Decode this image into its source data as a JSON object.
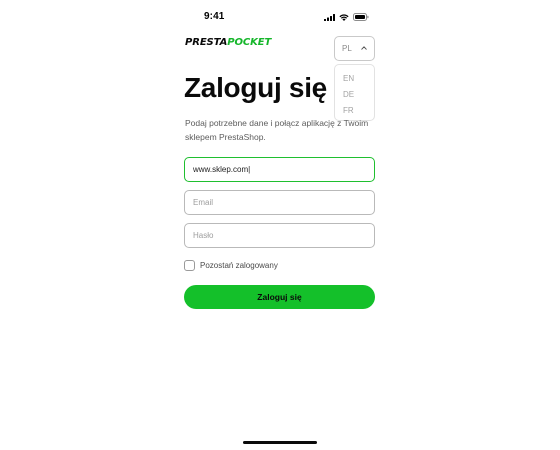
{
  "status_bar": {
    "time": "9:41",
    "icons": [
      "cellular-signal-icon",
      "wifi-icon",
      "battery-icon"
    ]
  },
  "header": {
    "logo_part1": "PRESTA",
    "logo_part2": "POCKET",
    "language": {
      "selected": "PL",
      "options": [
        "EN",
        "DE",
        "FR"
      ]
    }
  },
  "login": {
    "title": "Zaloguj się",
    "subtitle": "Podaj potrzebne dane i połącz aplikację z Twoim sklepem PrestaShop.",
    "url_value": "www.sklep.com|",
    "email_placeholder": "Email",
    "password_placeholder": "Hasło",
    "remember_label": "Pozostań zalogowany",
    "remember_checked": false,
    "submit_label": "Zaloguj się"
  },
  "colors": {
    "brand_green": "#14c02a",
    "active_border": "#1fbf2f",
    "text_dark": "#0a0a0a"
  }
}
